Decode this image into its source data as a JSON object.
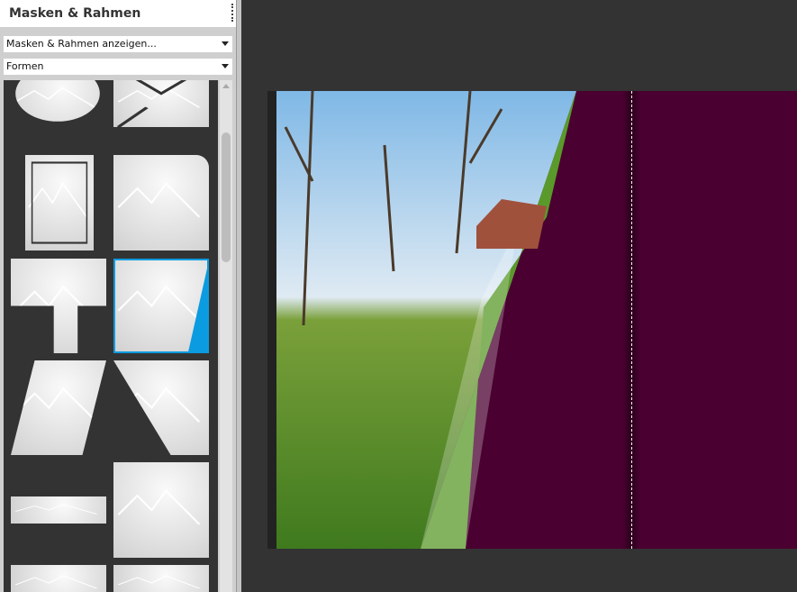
{
  "panel": {
    "title": "Masken & Rahmen",
    "dropdown1": "Masken & Rahmen anzeigen...",
    "dropdown2": "Formen"
  },
  "thumbnails": [
    "balloon",
    "envelope",
    "stamp",
    "rounded-corner",
    "puzzle-shape",
    "slanted-right",
    "parallelogram",
    "triangle-cut",
    "film-strip-horizontal",
    "film-strip-vertical",
    "grunge-frame",
    "film-edge-frame"
  ],
  "selected_thumbnail": "slanted-right",
  "colors": {
    "accent": "#0b9be0",
    "page_background": "#4a0030",
    "workspace": "#333333"
  }
}
